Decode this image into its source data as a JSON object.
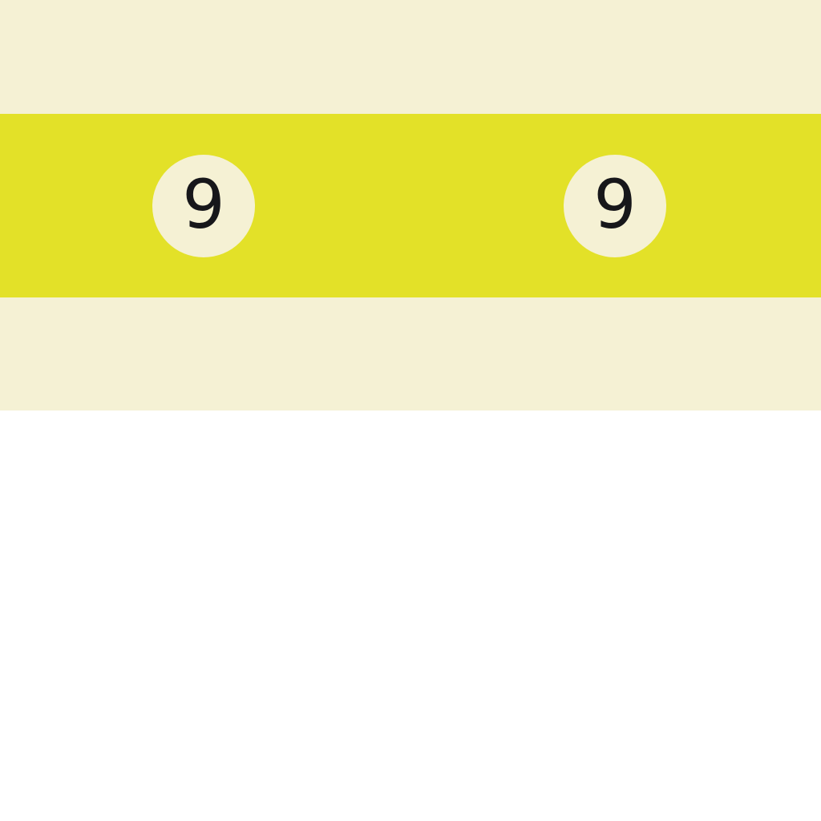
{
  "colors": {
    "background": "#f5f1d4",
    "stripe": "#e3e128",
    "ball": "#f5f1d4",
    "digit": "#17171a",
    "lower_area": "#ffffff"
  },
  "balls": [
    {
      "number": "9"
    },
    {
      "number": "9"
    }
  ]
}
